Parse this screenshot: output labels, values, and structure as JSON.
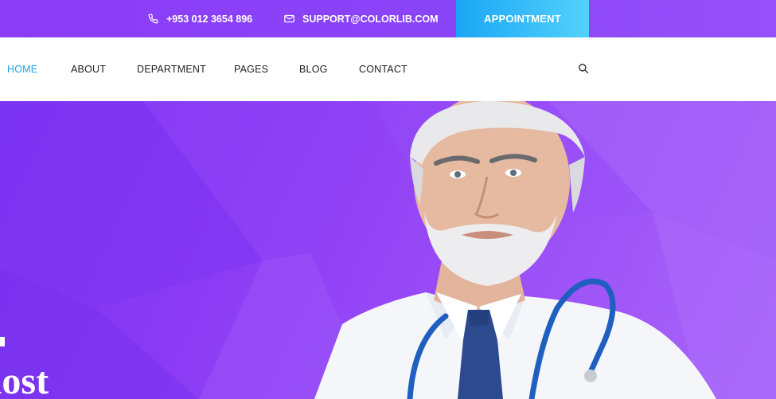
{
  "topbar": {
    "phone": "+953 012 3654 896",
    "email": "SUPPORT@COLORLIB.COM",
    "appointment_label": "APPOINTMENT",
    "phone_icon": "phone-icon",
    "email_icon": "envelope-icon"
  },
  "nav": {
    "items": [
      {
        "label": "HOME",
        "active": true
      },
      {
        "label": "ABOUT",
        "active": false
      },
      {
        "label": "DEPARTMENT",
        "active": false
      },
      {
        "label": "PAGES",
        "active": false
      },
      {
        "label": "BLOG",
        "active": false
      },
      {
        "label": "CONTACT",
        "active": false
      }
    ],
    "search_icon": "search-icon"
  },
  "hero": {
    "headline_fragment": "r most"
  },
  "colors": {
    "topbar_purple": "#8b3cf7",
    "appointment_blue": "#1aa6f5",
    "nav_active": "#1fa2e9",
    "hero_purple": "#8a3af4"
  }
}
